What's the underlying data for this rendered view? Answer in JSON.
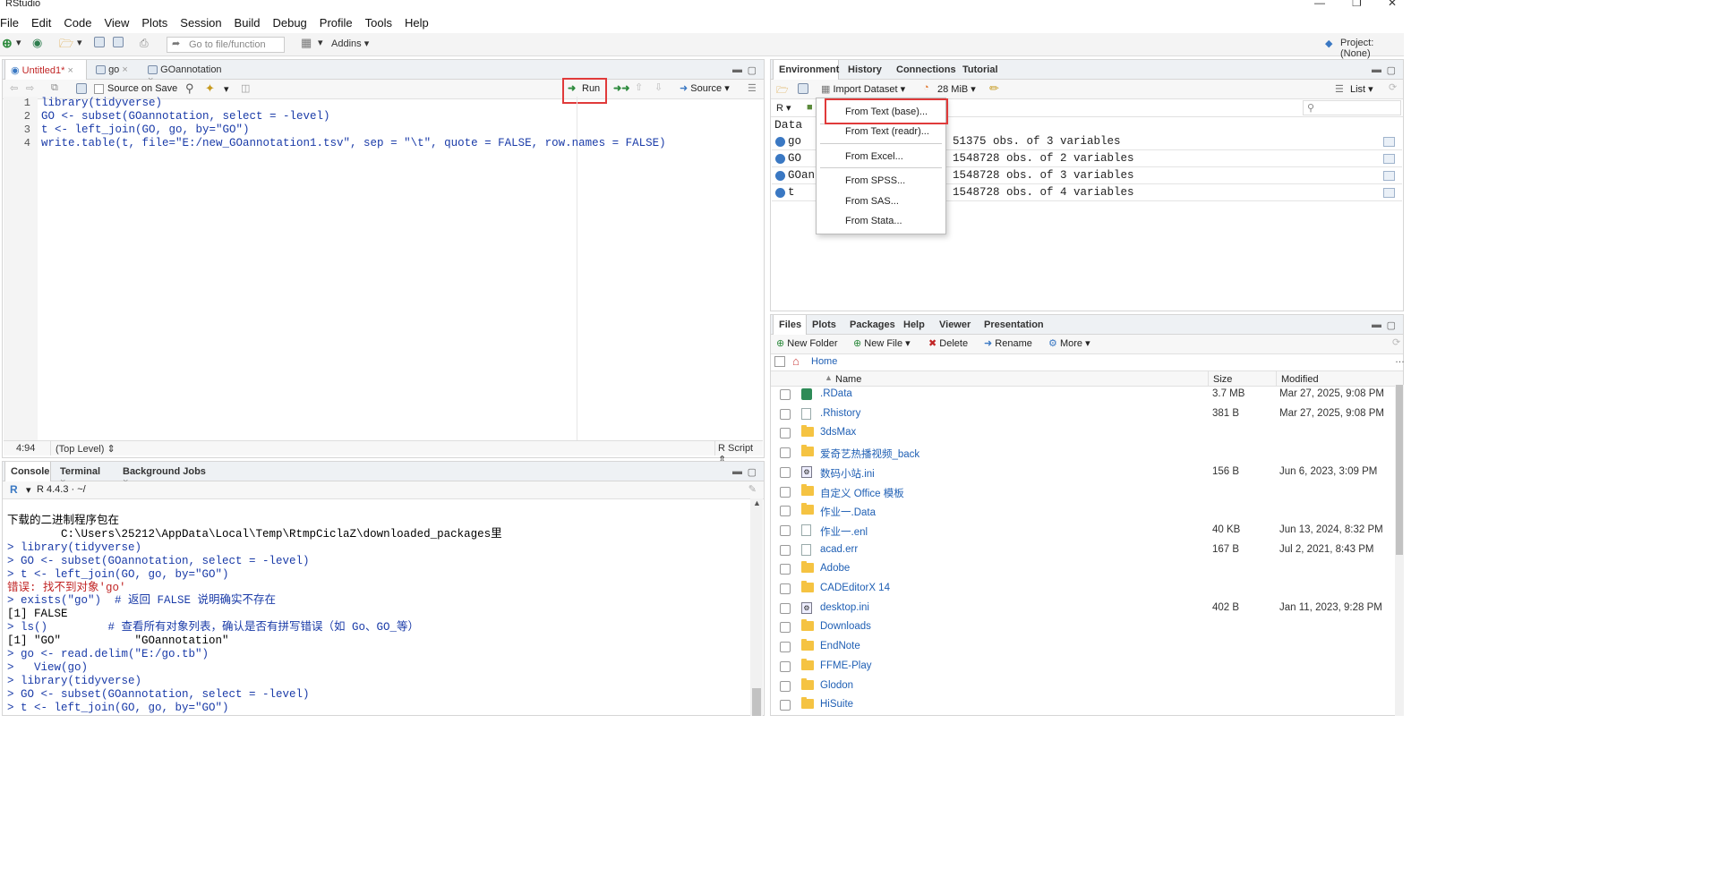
{
  "window": {
    "title": "RStudio"
  },
  "menu": [
    "File",
    "Edit",
    "Code",
    "View",
    "Plots",
    "Session",
    "Build",
    "Debug",
    "Profile",
    "Tools",
    "Help"
  ],
  "toolbar": {
    "goto_placeholder": "Go to file/function",
    "addins": "Addins",
    "project": "Project: (None)"
  },
  "editor": {
    "tabs": [
      "Untitled1*",
      "go",
      "GOannotation"
    ],
    "source_on_save": "Source on Save",
    "run": "Run",
    "source": "Source",
    "lines": [
      "library(tidyverse)",
      "GO <- subset(GOannotation, select = -level)",
      "t <- left_join(GO, go, by=\"GO\")",
      "write.table(t, file=\"E:/new_GOannotation1.tsv\", sep = \"\\t\", quote = FALSE, row.names = FALSE)"
    ],
    "status": {
      "position": "4:94",
      "scope": "(Top Level)",
      "type": "R Script"
    }
  },
  "console": {
    "tabs": [
      "Console",
      "Terminal",
      "Background Jobs"
    ],
    "r_version": "R 4.4.3 · ~/",
    "output": [
      {
        "t": "下载的二进制程序包在",
        "c": "n"
      },
      {
        "t": "        C:\\Users\\25212\\AppData\\Local\\Temp\\RtmpCiclaZ\\downloaded_packages里",
        "c": "n"
      },
      {
        "t": "> library(tidyverse)",
        "c": "b"
      },
      {
        "t": "> GO <- subset(GOannotation, select = -level)",
        "c": "b"
      },
      {
        "t": "> t <- left_join(GO, go, by=\"GO\")",
        "c": "b"
      },
      {
        "t": "错误: 找不到对象'go'",
        "c": "r"
      },
      {
        "t": "> exists(\"go\")  # 返回 FALSE 说明确实不存在",
        "c": "b"
      },
      {
        "t": "[1] FALSE",
        "c": "n"
      },
      {
        "t": "> ls()         # 查看所有对象列表，确认是否有拼写错误（如 Go、GO_等）",
        "c": "b"
      },
      {
        "t": "[1] \"GO\"           \"GOannotation\"",
        "c": "n"
      },
      {
        "t": "> go <- read.delim(\"E:/go.tb\")",
        "c": "b"
      },
      {
        "t": ">   View(go)",
        "c": "b"
      },
      {
        "t": "> library(tidyverse)",
        "c": "b"
      },
      {
        "t": "> GO <- subset(GOannotation, select = -level)",
        "c": "b"
      },
      {
        "t": "> t <- left_join(GO, go, by=\"GO\")",
        "c": "b"
      }
    ]
  },
  "environment": {
    "tabs": [
      "Environment",
      "History",
      "Connections",
      "Tutorial"
    ],
    "import_dataset": "Import Dataset",
    "memory": "28 MiB",
    "list_view": "List",
    "lang": "R",
    "section": "Data",
    "rows": [
      {
        "name": "go",
        "value": "51375 obs. of 3 variables"
      },
      {
        "name": "GO",
        "value": "1548728 obs. of 2 variables"
      },
      {
        "name": "GOann",
        "value": "1548728 obs. of 3 variables"
      },
      {
        "name": "t",
        "value": "1548728 obs. of 4 variables"
      }
    ],
    "import_menu": [
      "From Text (base)...",
      "From Text (readr)...",
      "From Excel...",
      "From SPSS...",
      "From SAS...",
      "From Stata..."
    ]
  },
  "files": {
    "tabs": [
      "Files",
      "Plots",
      "Packages",
      "Help",
      "Viewer",
      "Presentation"
    ],
    "actions": {
      "new_folder": "New Folder",
      "new_file": "New File",
      "delete": "Delete",
      "rename": "Rename",
      "more": "More"
    },
    "breadcrumb": "Home",
    "headers": {
      "name": "Name",
      "size": "Size",
      "modified": "Modified"
    },
    "rows": [
      {
        "icon": "rdata",
        "name": ".RData",
        "size": "3.7 MB",
        "modified": "Mar 27, 2025, 9:08 PM"
      },
      {
        "icon": "file",
        "name": ".Rhistory",
        "size": "381 B",
        "modified": "Mar 27, 2025, 9:08 PM"
      },
      {
        "icon": "folder",
        "name": "3dsMax",
        "size": "",
        "modified": ""
      },
      {
        "icon": "folder",
        "name": "爱奇艺热播视频_back",
        "size": "",
        "modified": ""
      },
      {
        "icon": "gear",
        "name": "数码小站.ini",
        "size": "156 B",
        "modified": "Jun 6, 2023, 3:09 PM"
      },
      {
        "icon": "folder",
        "name": "自定义 Office 模板",
        "size": "",
        "modified": ""
      },
      {
        "icon": "folder",
        "name": "作业一.Data",
        "size": "",
        "modified": ""
      },
      {
        "icon": "file",
        "name": "作业一.enl",
        "size": "40 KB",
        "modified": "Jun 13, 2024, 8:32 PM"
      },
      {
        "icon": "file",
        "name": "acad.err",
        "size": "167 B",
        "modified": "Jul 2, 2021, 8:43 PM"
      },
      {
        "icon": "folder",
        "name": "Adobe",
        "size": "",
        "modified": ""
      },
      {
        "icon": "folder",
        "name": "CADEditorX 14",
        "size": "",
        "modified": ""
      },
      {
        "icon": "gear",
        "name": "desktop.ini",
        "size": "402 B",
        "modified": "Jan 11, 2023, 9:28 PM"
      },
      {
        "icon": "folder",
        "name": "Downloads",
        "size": "",
        "modified": ""
      },
      {
        "icon": "folder",
        "name": "EndNote",
        "size": "",
        "modified": ""
      },
      {
        "icon": "folder",
        "name": "FFME-Play",
        "size": "",
        "modified": ""
      },
      {
        "icon": "folder",
        "name": "Glodon",
        "size": "",
        "modified": ""
      },
      {
        "icon": "folder",
        "name": "HiSuite",
        "size": "",
        "modified": ""
      }
    ]
  }
}
